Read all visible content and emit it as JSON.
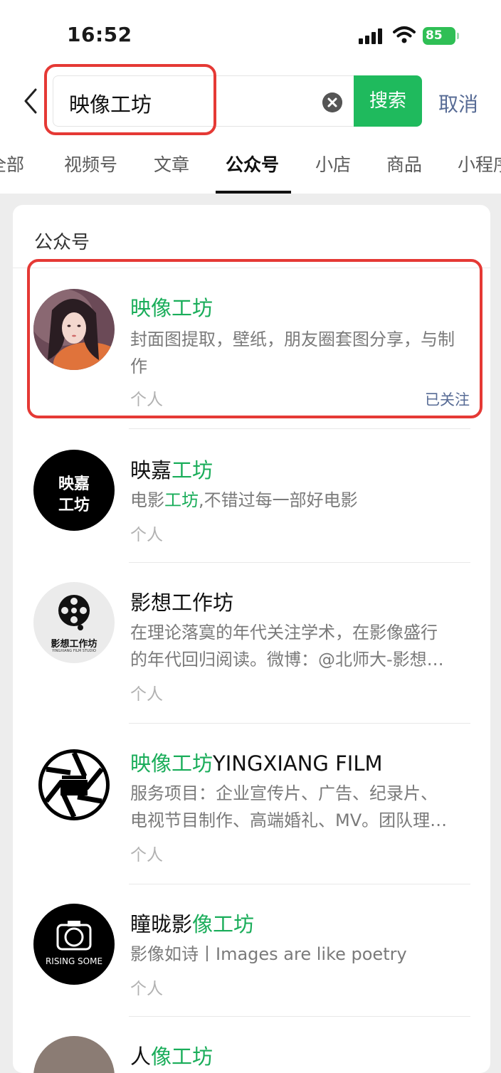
{
  "status": {
    "time": "16:52",
    "battery": "85"
  },
  "search": {
    "query": "映像工坊",
    "button": "搜索",
    "cancel": "取消"
  },
  "tabs": [
    {
      "label": "全部"
    },
    {
      "label": "视频号"
    },
    {
      "label": "文章"
    },
    {
      "label": "公众号",
      "active": true
    },
    {
      "label": "小店"
    },
    {
      "label": "商品"
    },
    {
      "label": "小程序"
    }
  ],
  "section_title": "公众号",
  "results": [
    {
      "name_hl": "映像工坊",
      "name_tail": "",
      "desc": "封面图提取，壁纸，朋友圈套图分享，与制作",
      "type": "个人",
      "followed": "已关注"
    },
    {
      "name_pre": "映嘉",
      "name_hl": "工坊",
      "desc_pre": "电影",
      "desc_hl": "工坊",
      "desc_tail": ",不错过每一部好电影",
      "type": "个人",
      "avatar_text_1": "映嘉",
      "avatar_text_2": "工坊"
    },
    {
      "name": "影想工作坊",
      "desc_line1": "在理论落寞的年代关注学术，在影像盛行",
      "desc_line2": "的年代回归阅读。微博：@北师大-影想…",
      "type": "个人",
      "avatar_text_1": "影想工作坊",
      "avatar_text_2": "YINGXIANG FILM STUDIO"
    },
    {
      "name_hl": "映像工坊",
      "name_tail": "YINGXIANG FILM",
      "desc_line1": "服务项目：企业宣传片、广告、纪录片、",
      "desc_line2": "电视节目制作、高端婚礼、MV。团队理…",
      "type": "个人"
    },
    {
      "name_pre": "瞳昽影",
      "name_hl": "像工坊",
      "desc": "影像如诗丨Images are like poetry",
      "type": "个人",
      "avatar_text": "RISING SOME"
    },
    {
      "name_pre": "人",
      "name_hl": "像工坊"
    }
  ],
  "colors": {
    "accent": "#1aad5a",
    "link": "#576b95",
    "highlight_box": "#e53935"
  }
}
